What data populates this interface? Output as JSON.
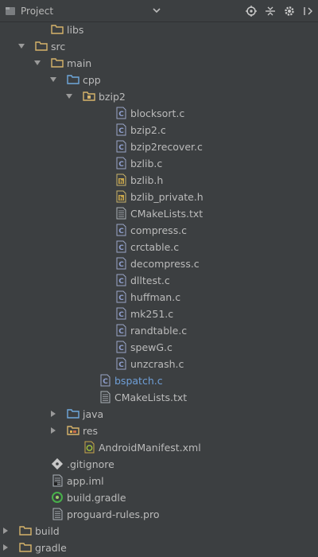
{
  "header": {
    "title": "Project"
  },
  "tree": [
    {
      "label": "libs",
      "icon": "folder-icon",
      "indent": 3,
      "arrow": "none"
    },
    {
      "label": "src",
      "icon": "folder-icon",
      "indent": 2,
      "arrow": "down"
    },
    {
      "label": "main",
      "icon": "folder-icon",
      "indent": 3,
      "arrow": "down"
    },
    {
      "label": "cpp",
      "icon": "source-folder-icon",
      "indent": 4,
      "arrow": "down"
    },
    {
      "label": "bzip2",
      "icon": "package-folder-icon",
      "indent": 5,
      "arrow": "down"
    },
    {
      "label": "blocksort.c",
      "icon": "c-file-icon",
      "indent": 7,
      "arrow": "none"
    },
    {
      "label": "bzip2.c",
      "icon": "c-file-icon",
      "indent": 7,
      "arrow": "none"
    },
    {
      "label": "bzip2recover.c",
      "icon": "c-file-icon",
      "indent": 7,
      "arrow": "none"
    },
    {
      "label": "bzlib.c",
      "icon": "c-file-icon",
      "indent": 7,
      "arrow": "none"
    },
    {
      "label": "bzlib.h",
      "icon": "h-file-icon",
      "indent": 7,
      "arrow": "none"
    },
    {
      "label": "bzlib_private.h",
      "icon": "h-file-icon",
      "indent": 7,
      "arrow": "none"
    },
    {
      "label": "CMakeLists.txt",
      "icon": "text-file-icon",
      "indent": 7,
      "arrow": "none"
    },
    {
      "label": "compress.c",
      "icon": "c-file-icon",
      "indent": 7,
      "arrow": "none"
    },
    {
      "label": "crctable.c",
      "icon": "c-file-icon",
      "indent": 7,
      "arrow": "none"
    },
    {
      "label": "decompress.c",
      "icon": "c-file-icon",
      "indent": 7,
      "arrow": "none"
    },
    {
      "label": "dlltest.c",
      "icon": "c-file-icon",
      "indent": 7,
      "arrow": "none"
    },
    {
      "label": "huffman.c",
      "icon": "c-file-icon",
      "indent": 7,
      "arrow": "none"
    },
    {
      "label": "mk251.c",
      "icon": "c-file-icon",
      "indent": 7,
      "arrow": "none"
    },
    {
      "label": "randtable.c",
      "icon": "c-file-icon",
      "indent": 7,
      "arrow": "none"
    },
    {
      "label": "spewG.c",
      "icon": "c-file-icon",
      "indent": 7,
      "arrow": "none"
    },
    {
      "label": "unzcrash.c",
      "icon": "c-file-icon",
      "indent": 7,
      "arrow": "none"
    },
    {
      "label": "bspatch.c",
      "icon": "c-file-icon",
      "indent": 6,
      "arrow": "none",
      "linked": true
    },
    {
      "label": "CMakeLists.txt",
      "icon": "text-file-icon",
      "indent": 6,
      "arrow": "none"
    },
    {
      "label": "java",
      "icon": "source-folder-icon",
      "indent": 4,
      "arrow": "right"
    },
    {
      "label": "res",
      "icon": "res-folder-icon",
      "indent": 4,
      "arrow": "right"
    },
    {
      "label": "AndroidManifest.xml",
      "icon": "manifest-icon",
      "indent": 5,
      "arrow": "none"
    },
    {
      "label": ".gitignore",
      "icon": "git-icon",
      "indent": 3,
      "arrow": "none"
    },
    {
      "label": "app.iml",
      "icon": "iml-file-icon",
      "indent": 3,
      "arrow": "none"
    },
    {
      "label": "build.gradle",
      "icon": "gradle-icon",
      "indent": 3,
      "arrow": "none"
    },
    {
      "label": "proguard-rules.pro",
      "icon": "text-file-icon",
      "indent": 3,
      "arrow": "none"
    },
    {
      "label": "build",
      "icon": "folder-icon",
      "indent": 1,
      "arrow": "right"
    },
    {
      "label": "gradle",
      "icon": "folder-icon",
      "indent": 1,
      "arrow": "right"
    }
  ]
}
